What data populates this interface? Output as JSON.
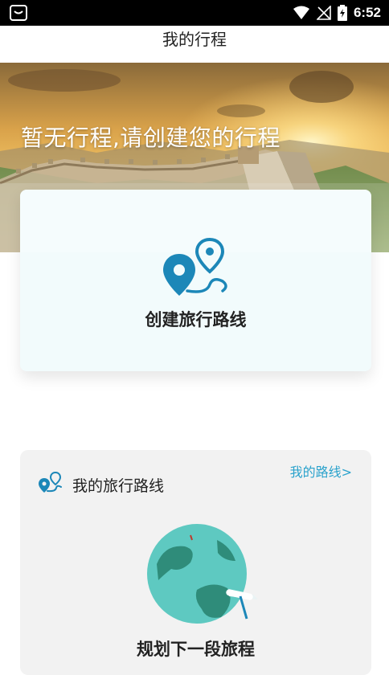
{
  "status_bar": {
    "time": "6:52"
  },
  "header": {
    "title": "我的行程"
  },
  "banner": {
    "title": "暂无行程,请创建您的行程"
  },
  "create_card": {
    "label": "创建旅行路线"
  },
  "my_routes": {
    "title": "我的旅行路线",
    "link": "我的路线>",
    "empty_label": "规划下一段旅程"
  },
  "colors": {
    "accent": "#2aa2cc",
    "route_icon": "#1c87b8",
    "globe": "#58c7c0"
  }
}
